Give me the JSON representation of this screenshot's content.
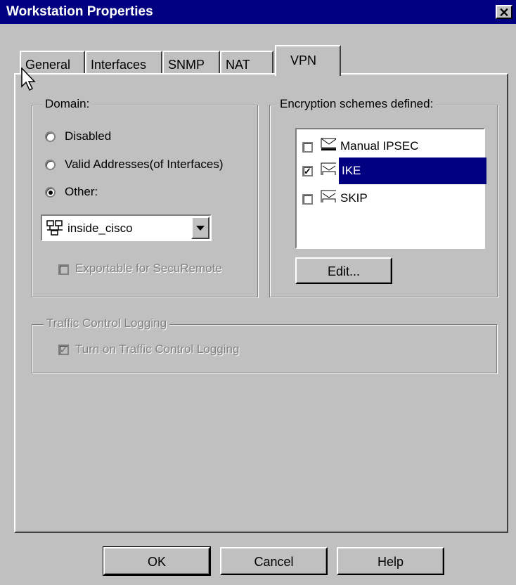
{
  "window": {
    "title": "Workstation Properties",
    "close_glyph": "✕"
  },
  "tabs": [
    {
      "label": "General"
    },
    {
      "label": "Interfaces"
    },
    {
      "label": "SNMP"
    },
    {
      "label": "NAT"
    },
    {
      "label": "VPN",
      "active": true
    }
  ],
  "domain": {
    "legend": "Domain:",
    "options": [
      {
        "label": "Disabled",
        "selected": false
      },
      {
        "label": "Valid Addresses(of Interfaces)",
        "selected": false
      },
      {
        "label": "Other:",
        "selected": true
      }
    ],
    "combo_value": "inside_cisco",
    "exportable_label": "Exportable for SecuRemote",
    "exportable_checked": false
  },
  "encryption": {
    "legend": "Encryption schemes defined:",
    "schemes": [
      {
        "label": "Manual IPSEC",
        "icon_text": "IPSEC",
        "checked": false,
        "selected": false
      },
      {
        "label": "IKE",
        "icon_text": "IKE",
        "checked": true,
        "selected": true
      },
      {
        "label": "SKIP",
        "icon_text": "SKIP",
        "checked": false,
        "selected": false
      }
    ],
    "edit_label": "Edit..."
  },
  "traffic": {
    "legend": "Traffic Control Logging",
    "checkbox_label": "Turn on Traffic Control Logging",
    "checked": true
  },
  "buttons": {
    "ok": "OK",
    "cancel": "Cancel",
    "help": "Help"
  },
  "colors": {
    "title_bar": "#000080",
    "face": "#c0c0c0",
    "selection": "#000080"
  }
}
